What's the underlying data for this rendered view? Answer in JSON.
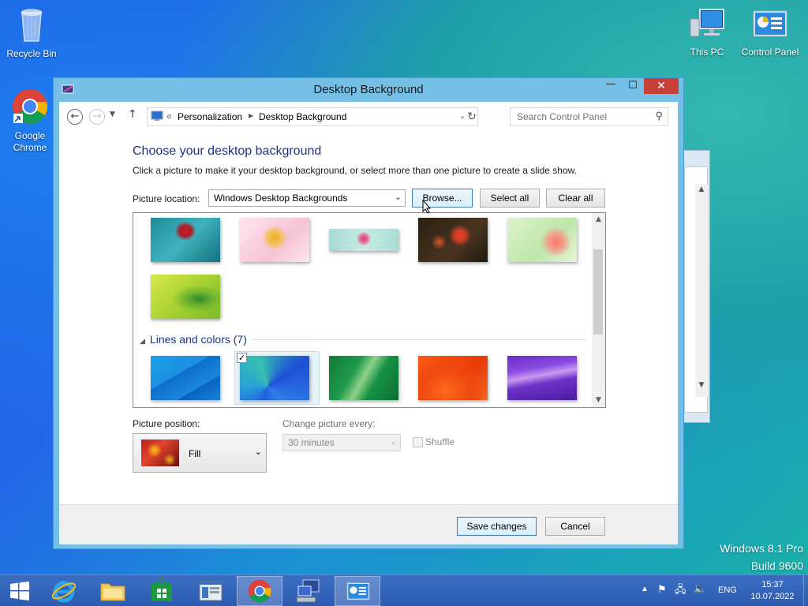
{
  "desktop": {
    "icons": [
      {
        "label": "Recycle Bin",
        "icon": "recycle-bin-icon"
      },
      {
        "label": "Google\nChrome",
        "icon": "chrome-icon"
      },
      {
        "label": "This PC",
        "icon": "computer-icon"
      },
      {
        "label": "Control Panel",
        "icon": "control-panel-icon"
      }
    ],
    "watermark_line1": "Windows 8.1 Pro",
    "watermark_line2": "Build 9600"
  },
  "window": {
    "title": "Desktop Background",
    "minimize": "—",
    "maximize": "☐",
    "close": "✕",
    "breadcrumb": {
      "overflow": "«",
      "items": [
        "Personalization",
        "Desktop Background"
      ]
    },
    "search_placeholder": "Search Control Panel",
    "heading": "Choose your desktop background",
    "description": "Click a picture to make it your desktop background, or select more than one picture to create a slide show.",
    "picture_location_label": "Picture location:",
    "picture_location_value": "Windows Desktop Backgrounds",
    "browse_label": "Browse...",
    "select_all_label": "Select all",
    "clear_all_label": "Clear all",
    "group_header": "Lines and colors (7)",
    "picture_position_label": "Picture position:",
    "picture_position_value": "Fill",
    "change_picture_label": "Change picture every:",
    "change_picture_value": "30 minutes",
    "shuffle_label": "Shuffle",
    "save_label": "Save changes",
    "cancel_label": "Cancel"
  },
  "taskbar": {
    "language": "ENG",
    "time": "15:37",
    "date": "10.07.2022"
  },
  "colors": {
    "heading": "#1e3287",
    "close_button": "#c7413b",
    "window_frame": "#73bfe6",
    "taskbar": "#2c5bb0"
  }
}
